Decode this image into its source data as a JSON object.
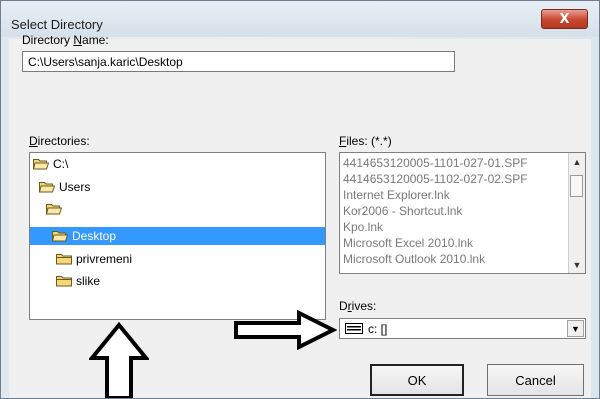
{
  "window": {
    "title": "Select Directory",
    "close_label": "X"
  },
  "directory_name": {
    "label_pre": "Directory ",
    "label_mnemonic": "N",
    "label_post": "ame:",
    "value": "C:\\Users\\sanja.karic\\Desktop"
  },
  "directories": {
    "label_mnemonic": "D",
    "label_post": "irectories:",
    "items": [
      {
        "label": "C:\\",
        "state": "open"
      },
      {
        "label": "Users",
        "state": "open"
      },
      {
        "label": "",
        "state": "open"
      },
      {
        "label": "Desktop",
        "state": "open",
        "selected": true
      },
      {
        "label": "privremeni",
        "state": "closed"
      },
      {
        "label": "slike",
        "state": "closed"
      }
    ]
  },
  "files": {
    "label_mnemonic": "F",
    "label_post": "iles: (*.*)",
    "items": [
      "4414653120005-1101-027-01.SPF",
      "4414653120005-1102-027-02.SPF",
      "Internet Explorer.lnk",
      "Kor2006 - Shortcut.lnk",
      "Kpo.lnk",
      "Microsoft Excel 2010.lnk",
      "Microsoft Outlook 2010.lnk"
    ]
  },
  "drives": {
    "label_pre": "D",
    "label_mnemonic": "r",
    "label_post": "ives:",
    "value": "c: []",
    "icon": "drive-icon"
  },
  "buttons": {
    "ok": "OK",
    "cancel": "Cancel"
  },
  "colors": {
    "selection": "#3399ff",
    "close": "#c8452f",
    "folder": "#f5d77a"
  }
}
